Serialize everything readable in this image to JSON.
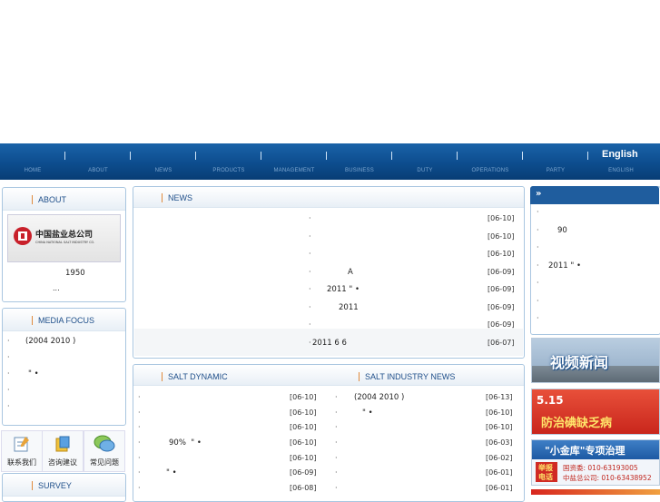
{
  "nav": {
    "english_label": "English",
    "items": [
      "HOME",
      "ABOUT",
      "NEWS",
      "PRODUCTS",
      "MANAGEMENT",
      "BUSINESS",
      "DUTY",
      "OPERATIONS",
      "PARTY",
      "ENGLISH"
    ]
  },
  "about": {
    "title": "ABOUT",
    "logo_text": "中国盐业总公司",
    "logo_subtext": "CHINA NATIONAL SALT INDUSTRY CO.",
    "year": "1950",
    "more": "..."
  },
  "media_focus": {
    "title": "MEDIA FOCUS",
    "items": [
      "(2004 2010 )",
      "",
      "\" •",
      "",
      ""
    ]
  },
  "quick_links": [
    {
      "label": "联系我们",
      "icon": "contact-icon"
    },
    {
      "label": "咨询建议",
      "icon": "suggestion-icon"
    },
    {
      "label": "常见问题",
      "icon": "faq-icon"
    }
  ],
  "survey": {
    "title": "SURVEY"
  },
  "news": {
    "title": "NEWS",
    "items": [
      {
        "text": "",
        "date": "[06-10]"
      },
      {
        "text": "",
        "date": "[06-10]"
      },
      {
        "text": "",
        "date": "[06-10]"
      },
      {
        "text": "A",
        "date": "[06-09]"
      },
      {
        "text": "2011 \" •",
        "date": "[06-09]"
      },
      {
        "text": "2011",
        "date": "[06-09]"
      },
      {
        "text": "",
        "date": "[06-09]"
      },
      {
        "text": "2011 6 6",
        "date": "[06-07]"
      }
    ]
  },
  "salt_dynamic": {
    "title": "SALT DYNAMIC",
    "items": [
      {
        "text": "",
        "date": "[06-10]"
      },
      {
        "text": "",
        "date": "[06-10]"
      },
      {
        "text": "",
        "date": "[06-10]"
      },
      {
        "text": "90%  \" •",
        "date": "[06-10]"
      },
      {
        "text": "",
        "date": "[06-10]"
      },
      {
        "text": "\" •",
        "date": "[06-09]"
      },
      {
        "text": "",
        "date": "[06-08]"
      }
    ]
  },
  "salt_industry_news": {
    "title": "SALT INDUSTRY NEWS",
    "items": [
      {
        "text": "(2004 2010 )",
        "date": "[06-13]"
      },
      {
        "text": "\" •",
        "date": "[06-10]"
      },
      {
        "text": "",
        "date": "[06-10]"
      },
      {
        "text": "",
        "date": "[06-03]"
      },
      {
        "text": "",
        "date": "[06-02]"
      },
      {
        "text": "",
        "date": "[06-01]"
      },
      {
        "text": "",
        "date": "[06-01]"
      }
    ]
  },
  "right_panel": {
    "header": "»",
    "items": [
      "",
      "90",
      "",
      "2011 \" •",
      "",
      "",
      ""
    ]
  },
  "banners": {
    "video": "视频新闻",
    "iodine_date": "5.15",
    "iodine_title": "防治碘缺乏病",
    "treasury_title": "\"小金库\"专项治理",
    "report_label_1": "举报",
    "report_label_2": "电话",
    "report_line1": "国资委: 010-63193005",
    "report_line2": "中盐总公司: 010-63438952"
  },
  "colors": {
    "nav": "#0d4d8e",
    "title": "#1f4f8a",
    "border": "#a9c6e0",
    "accent": "#e08a3c"
  }
}
